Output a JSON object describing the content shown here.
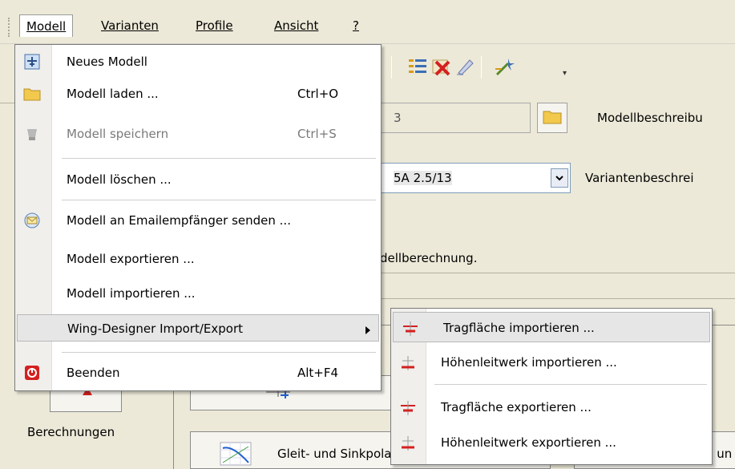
{
  "menubar": {
    "items": [
      "Modell",
      "Varianten",
      "Profile",
      "Ansicht",
      "?"
    ]
  },
  "form": {
    "model_field_value": "3",
    "model_desc_label": "Modellbeschreibu",
    "variant_field_value": "5A 2.5/13",
    "variant_desc_label": "Variantenbeschrei",
    "status_text": "dellberechnung."
  },
  "menu": {
    "items": [
      {
        "label": "Neues Modell",
        "shortcut": "",
        "icon": "new-model-icon"
      },
      {
        "label": "Modell laden ...",
        "shortcut": "Ctrl+O",
        "icon": "folder-icon"
      },
      {
        "label": "Modell speichern",
        "shortcut": "Ctrl+S",
        "icon": "save-icon",
        "disabled": true
      },
      {
        "label": "Modell löschen ...",
        "shortcut": ""
      },
      {
        "label": "Modell an Emailempfänger senden ...",
        "shortcut": "",
        "icon": "email-icon"
      },
      {
        "label": "Modell exportieren ...",
        "shortcut": ""
      },
      {
        "label": "Modell importieren ...",
        "shortcut": ""
      },
      {
        "label": "Wing-Designer Import/Export",
        "shortcut": "",
        "submenu": true
      },
      {
        "label": "Beenden",
        "shortcut": "Alt+F4",
        "icon": "exit-icon"
      }
    ]
  },
  "submenu": {
    "items": [
      {
        "label": "Tragfläche importieren ...",
        "icon": "wing-import-icon"
      },
      {
        "label": "Höhenleitwerk importieren ...",
        "icon": "stabilizer-import-icon"
      },
      {
        "label": "Tragfläche exportieren ...",
        "icon": "wing-export-icon"
      },
      {
        "label": "Höhenleitwerk exportieren ...",
        "icon": "stabilizer-export-icon"
      }
    ]
  },
  "left": {
    "berechnungen_label": "Berechnungen"
  },
  "bottom": {
    "polar_button_label": "Gleit- und Sinkpolare anzeigen",
    "right_button_label": "Gleit- un"
  },
  "colors": {
    "accent_red": "#D42020",
    "folder_yellow": "#F2C94C"
  }
}
